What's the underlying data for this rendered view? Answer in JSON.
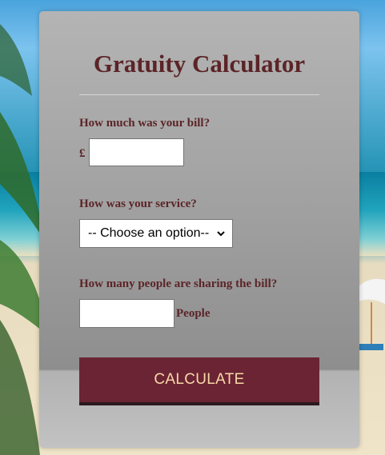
{
  "calculator": {
    "title": "Gratuity Calculator",
    "bill": {
      "label": "How much was your bill?",
      "currency": "£",
      "value": ""
    },
    "service": {
      "label": "How was your service?",
      "selected": "-- Choose an option--"
    },
    "people": {
      "label": "How many people are sharing the bill?",
      "value": "",
      "suffix": "People"
    },
    "calculate_label": "CALCULATE"
  },
  "colors": {
    "accent_text": "#5c2427",
    "button_bg": "#6b2433",
    "button_text": "#f7d7a8"
  },
  "icons": {
    "select_chevron": "chevron-down-icon"
  }
}
